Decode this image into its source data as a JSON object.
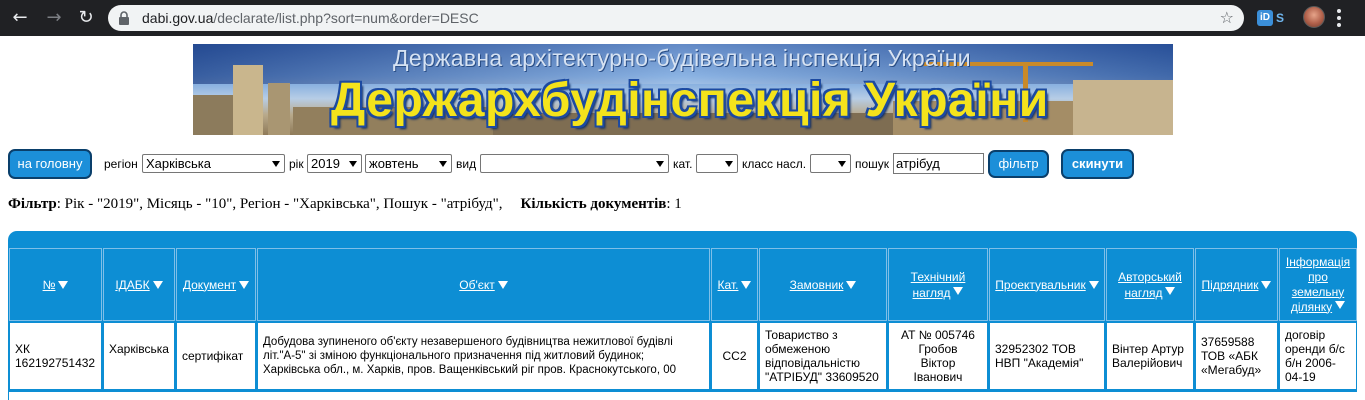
{
  "browser": {
    "url_host": "dabi.gov.ua",
    "url_path": "/declarate/list.php?sort=num&order=DESC",
    "back_icon": "arrow-left-icon",
    "forward_icon": "arrow-right-icon",
    "reload_icon": "reload-icon",
    "star_icon": "star-outline-icon",
    "extension_label": "iD",
    "extension2_label": "S"
  },
  "banner": {
    "subtitle": "Державна архітектурно-будівельна інспекція України",
    "title": "Держархбудінспекція України",
    "title_color": "#f4e31c"
  },
  "filters": {
    "home_button": "на головну",
    "region_label": "регіон",
    "region_value": "Харківська",
    "year_label": "рік",
    "year_value": "2019",
    "month_value": "жовтень",
    "type_label": "вид",
    "type_value": "",
    "category_label": "кат.",
    "category_value": "",
    "class_label": "класс насл.",
    "class_value": "",
    "search_label": "пошук",
    "search_value": "атрібуд",
    "filter_button": "фільтр",
    "reset_button": "скинути",
    "button_color": "#1c8fd9"
  },
  "summary": {
    "filter_label": "Фільтр",
    "filter_text": ": Рік - \"2019\", Місяць - \"10\", Регіон - \"Харківська\", Пошук - \"атрібуд\",",
    "count_label": "Кількість документів",
    "count_text": ": 1"
  },
  "table": {
    "header_color": "#0d8ed4",
    "headers": [
      {
        "label": "№"
      },
      {
        "label": "ІДАБК"
      },
      {
        "label": "Документ"
      },
      {
        "label": "Об'єкт"
      },
      {
        "label": "Кат."
      },
      {
        "label": "Замовник"
      },
      {
        "line1": "Технічний",
        "line2": "нагляд"
      },
      {
        "label": "Проектувальник"
      },
      {
        "line1": "Авторський",
        "line2": "нагляд"
      },
      {
        "label": "Підрядник"
      },
      {
        "line1": "Інформація",
        "line2": "про",
        "line3": "земельну",
        "line4": "ділянку"
      }
    ],
    "rows": [
      {
        "num_line1": "ХК",
        "num_line2": "162192751432",
        "idabk": "Харківська",
        "document": "сертифікат",
        "object_line1": "Добудова зупиненого об'єкту незавершеного будівництва нежитлової будівлі",
        "object_line2": "літ.\"А-5\" зі зміною функціонального призначення під житловий будинок;",
        "object_line3": "Харківська обл., м. Харків, пров. Ващенківський ріг пров. Краснокутського, 00",
        "category": "СС2",
        "customer_line1": "Товариство з",
        "customer_line2": "обмеженою",
        "customer_line3": "відповідальністю",
        "customer_line4": "\"АТРІБУД\" 33609520",
        "tech_line1": "АТ № 005746",
        "tech_line2": "Гробов",
        "tech_line3": "Віктор",
        "tech_line4": "Іванович",
        "designer_line1": "32952302 ТОВ",
        "designer_line2": "НВП \"Академія\"",
        "author_line1": "Вінтер Артур",
        "author_line2": "Валерійович",
        "contractor_line1": "37659588",
        "contractor_line2": "ТОВ «АБК",
        "contractor_line3": "«Мегабуд»",
        "land_line1": "договір",
        "land_line2": "оренди б/с",
        "land_line3": "б/н 2006-",
        "land_line4": "04-19"
      }
    ]
  }
}
